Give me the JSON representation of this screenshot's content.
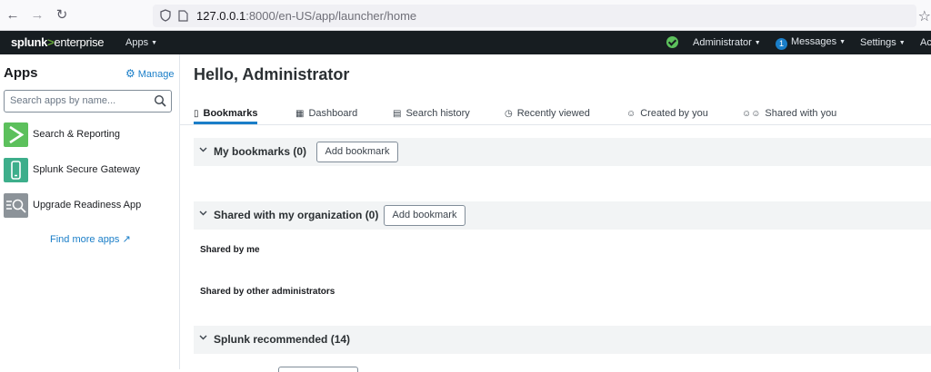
{
  "browser": {
    "url_host": "127.0.0.1",
    "url_rest": ":8000/en-US/app/launcher/home"
  },
  "topnav": {
    "logo_splunk": "splunk",
    "logo_gt": ">",
    "logo_enterprise": "enterprise",
    "apps": "Apps",
    "user": "Administrator",
    "messages_count": "1",
    "messages": "Messages",
    "settings": "Settings",
    "activity_partial": "Ac",
    "health_color": "#5cc05c"
  },
  "sidebar": {
    "title": "Apps",
    "manage": "Manage",
    "search_placeholder": "Search apps by name...",
    "apps": [
      {
        "label": "Search & Reporting",
        "icon": "search-reporting-icon",
        "color": "#5cc05c"
      },
      {
        "label": "Splunk Secure Gateway",
        "icon": "secure-gateway-icon",
        "color": "#3dae8b"
      },
      {
        "label": "Upgrade Readiness App",
        "icon": "upgrade-readiness-icon",
        "color": "#8c9399"
      }
    ],
    "find_more": "Find more apps"
  },
  "main": {
    "greeting": "Hello, Administrator",
    "tabs": [
      {
        "label": "Bookmarks",
        "icon": "bookmark-icon",
        "active": true
      },
      {
        "label": "Dashboard",
        "icon": "dashboard-icon",
        "active": false
      },
      {
        "label": "Search history",
        "icon": "search-history-icon",
        "active": false
      },
      {
        "label": "Recently viewed",
        "icon": "clock-icon",
        "active": false
      },
      {
        "label": "Created by you",
        "icon": "user-icon",
        "active": false
      },
      {
        "label": "Shared with you",
        "icon": "users-icon",
        "active": false
      }
    ],
    "sections": {
      "my_bookmarks": {
        "title": "My bookmarks (0)",
        "button": "Add bookmark"
      },
      "shared_org": {
        "title": "Shared with my organization (0)",
        "button": "Add bookmark"
      },
      "shared_by_me": "Shared by me",
      "shared_by_admins": "Shared by other administrators",
      "recommended": {
        "title": "Splunk recommended (14)"
      }
    }
  }
}
